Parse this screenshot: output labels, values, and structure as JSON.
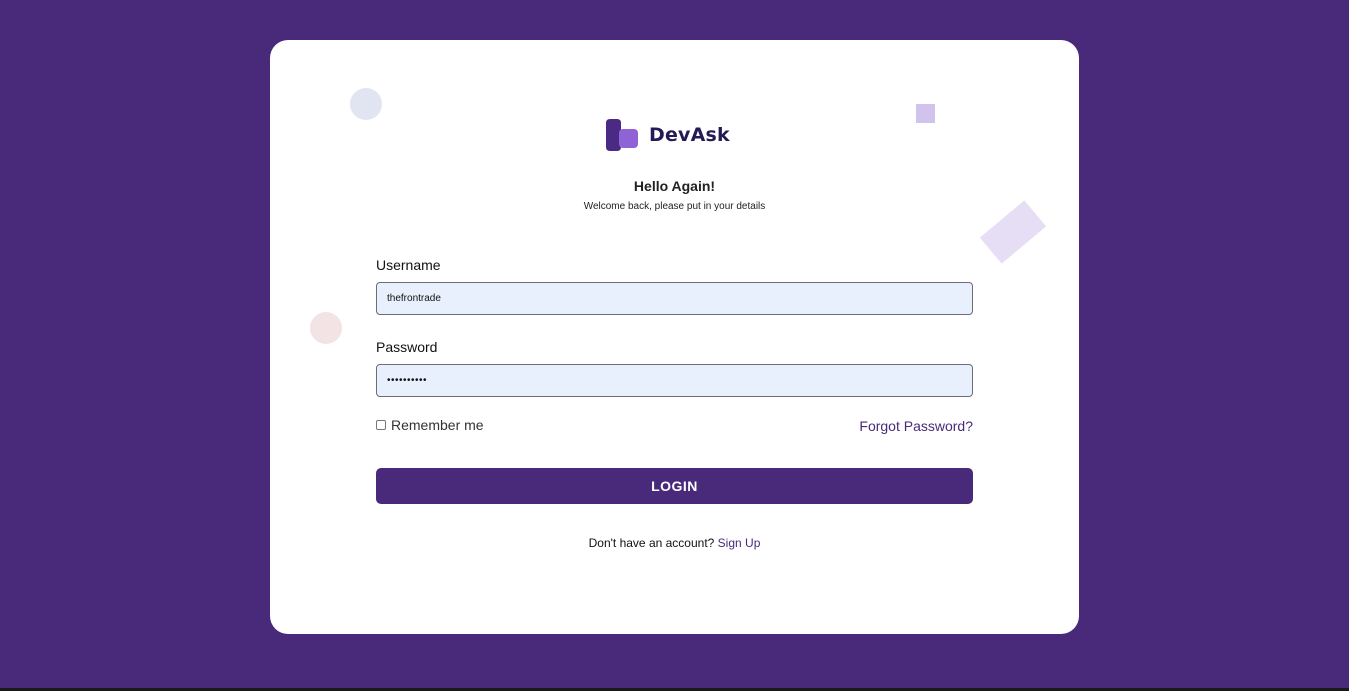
{
  "colors": {
    "page_background": "#492a7a",
    "card_background": "#ffffff",
    "accent": "#492a7a",
    "input_background": "#e8f0fe",
    "logo_dark": "#4b2a85",
    "logo_light": "#8f63d6"
  },
  "brand": {
    "name": "DevAsk",
    "logo_icon": "devask-logo-icon"
  },
  "header": {
    "title": "Hello Again!",
    "subtitle": "Welcome back, please put in your details"
  },
  "form": {
    "username": {
      "label": "Username",
      "value": "thefrontrade"
    },
    "password": {
      "label": "Password",
      "masked_value": "••••••••••"
    },
    "remember_me": {
      "label": "Remember me",
      "checked": false
    },
    "forgot_password_link": "Forgot Password?",
    "submit_label": "LOGIN"
  },
  "footer": {
    "prompt": "Don't have an account?",
    "signup_link": "Sign Up"
  }
}
